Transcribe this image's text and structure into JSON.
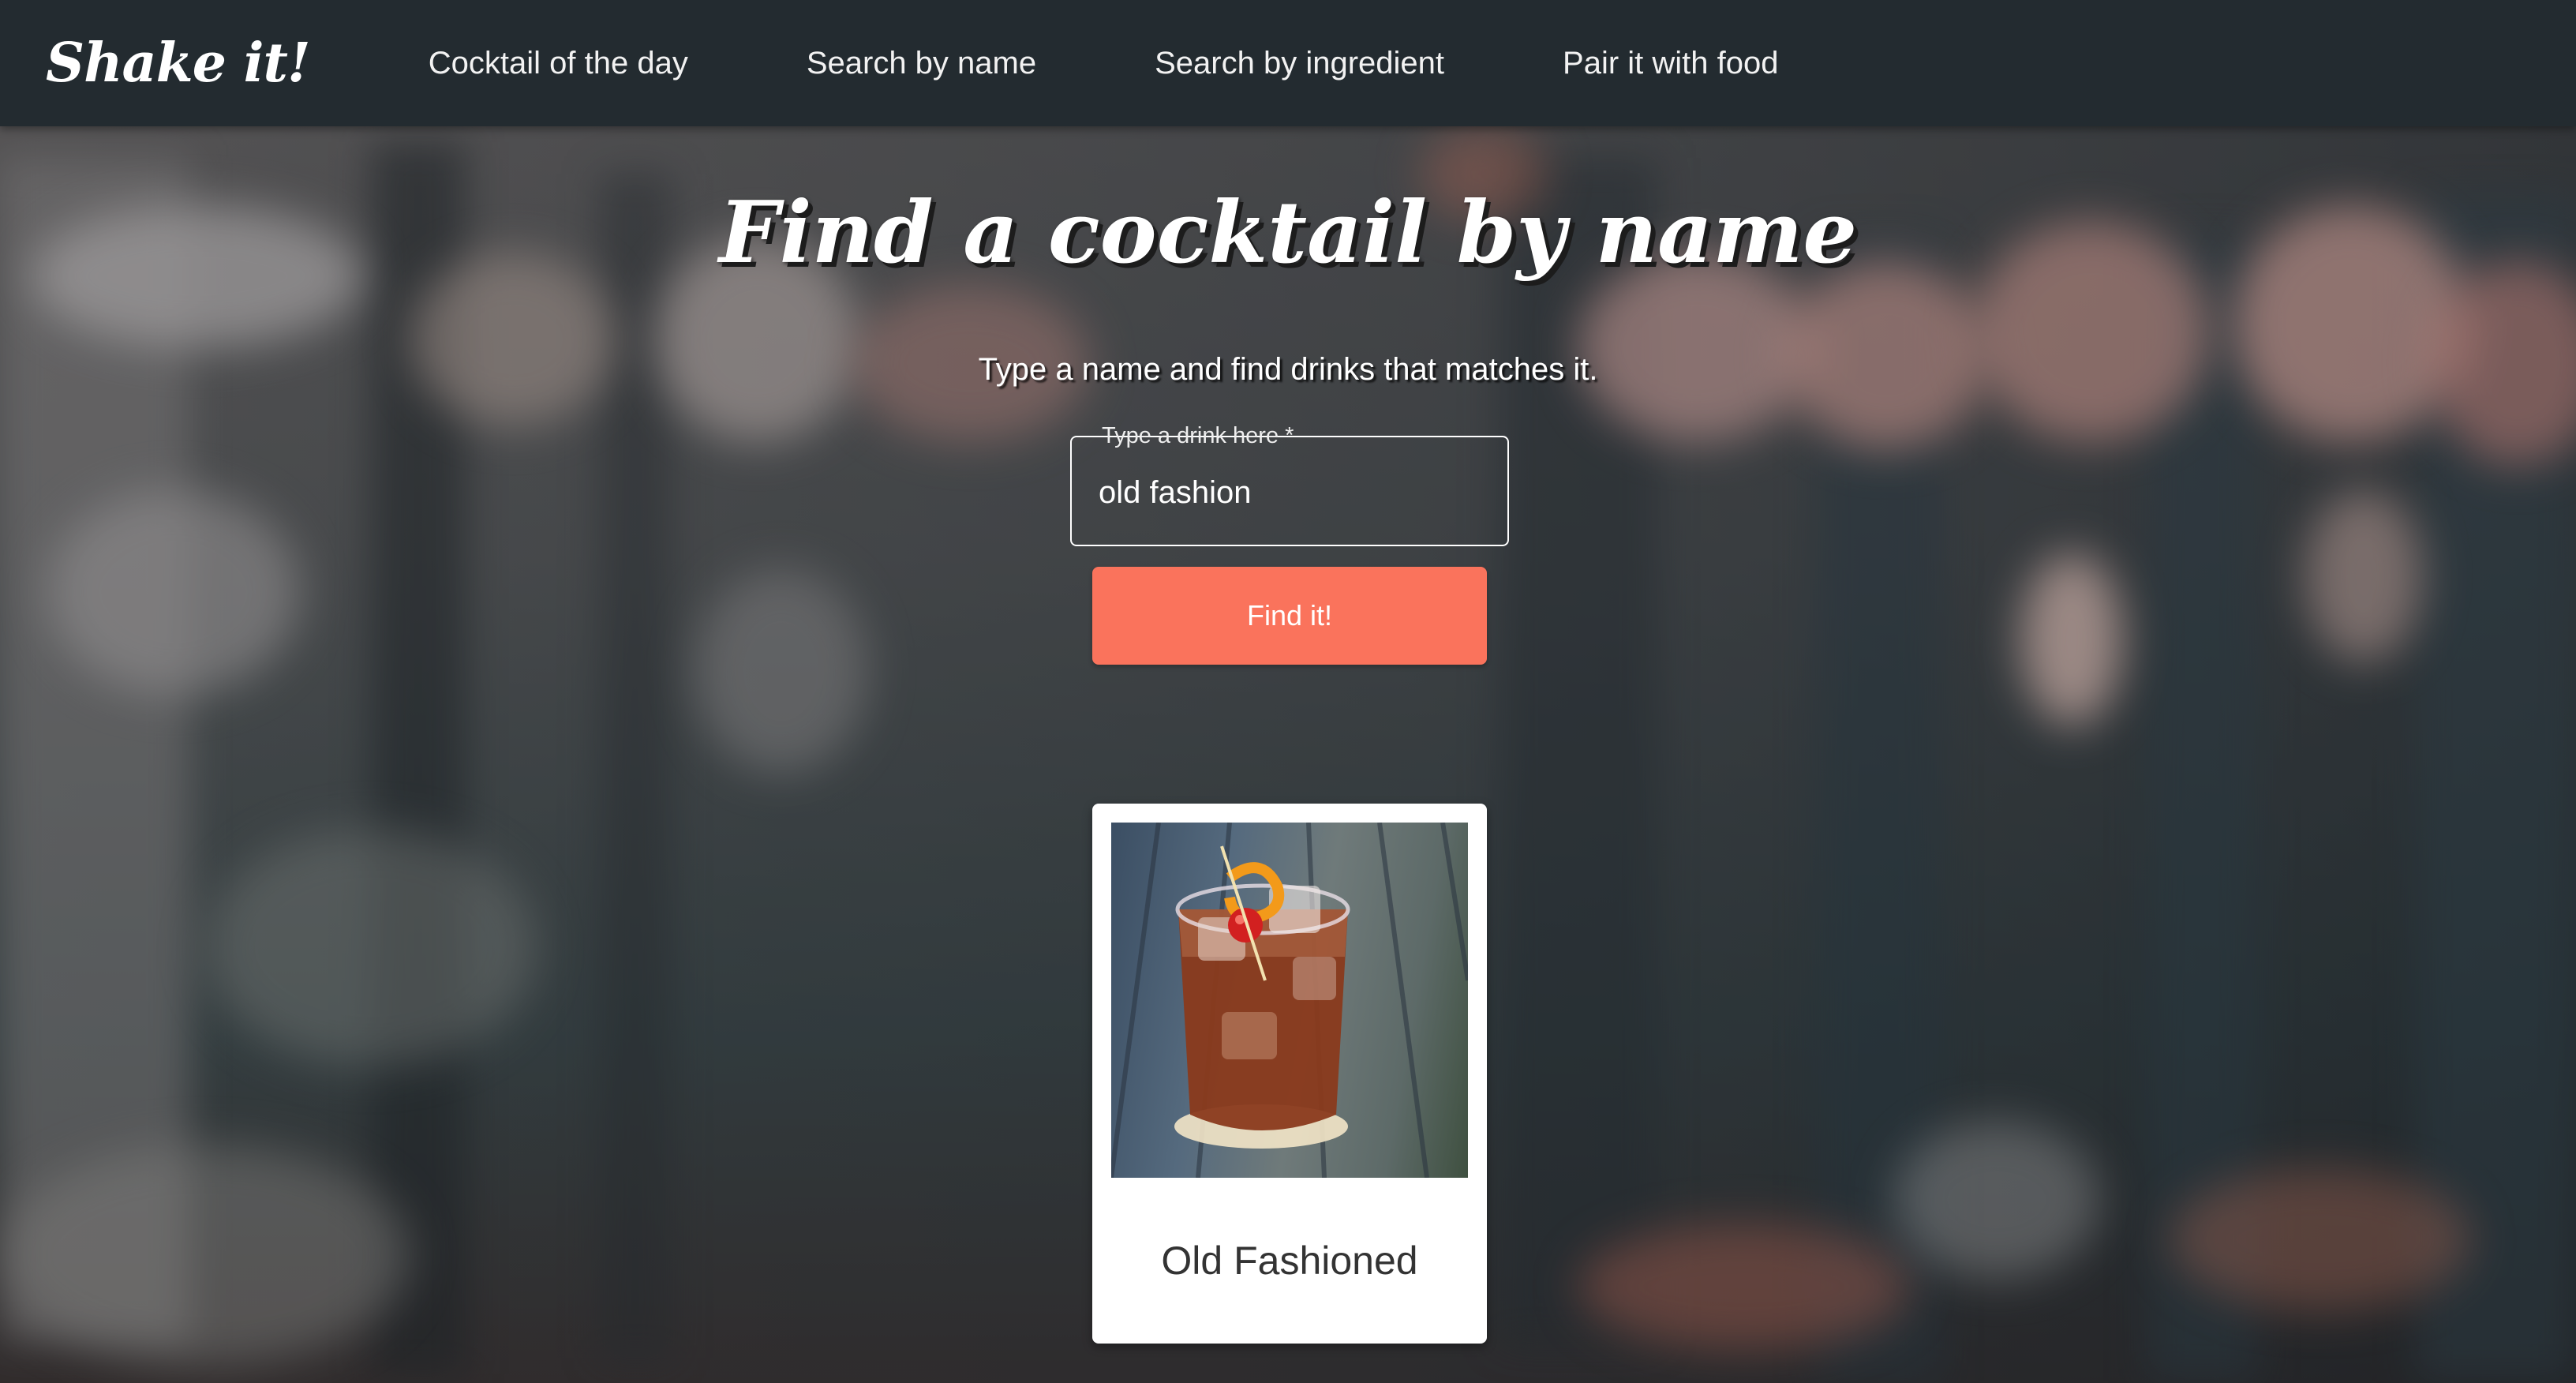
{
  "navbar": {
    "logo": "Shake it!",
    "links": [
      {
        "label": "Cocktail of the day"
      },
      {
        "label": "Search by name"
      },
      {
        "label": "Search by ingredient"
      },
      {
        "label": "Pair it with food"
      }
    ]
  },
  "hero": {
    "title": "Find a cocktail by name",
    "subtitle": "Type a name and find drinks that matches it.",
    "search": {
      "label": "Type a drink here *",
      "value": "old fashion"
    },
    "button_label": "Find it!"
  },
  "results": [
    {
      "name": "Old Fashioned"
    }
  ],
  "colors": {
    "navbar": "#232b30",
    "accent": "#fa735c",
    "card": "#ffffff"
  }
}
